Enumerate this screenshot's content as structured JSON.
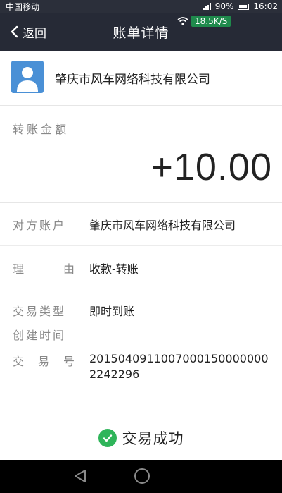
{
  "status_bar": {
    "carrier": "中国移动",
    "battery": "90%",
    "time": "16:02",
    "net_speed": "18.5K/S"
  },
  "nav": {
    "back_label": "返回",
    "title": "账单详情"
  },
  "merchant": {
    "name": "肇庆市风车网络科技有限公司"
  },
  "amount": {
    "label": "转账金额",
    "value": "+10.00"
  },
  "details": {
    "counterparty_label": "对方账户",
    "counterparty_value": "肇庆市风车网络科技有限公司",
    "reason_label_1": "理",
    "reason_label_2": "由",
    "reason_value": "收款-转账",
    "type_label": "交易类型",
    "type_value": "即时到账",
    "created_label": "创建时间",
    "txn_label_1": "交",
    "txn_label_2": "易",
    "txn_label_3": "号",
    "txn_value": "2015040911007000150000000 2242296"
  },
  "result": {
    "text": "交易成功"
  },
  "colors": {
    "nav_bg": "#262a36",
    "success_green": "#2fb55a",
    "avatar_blue": "#4a90d6"
  }
}
